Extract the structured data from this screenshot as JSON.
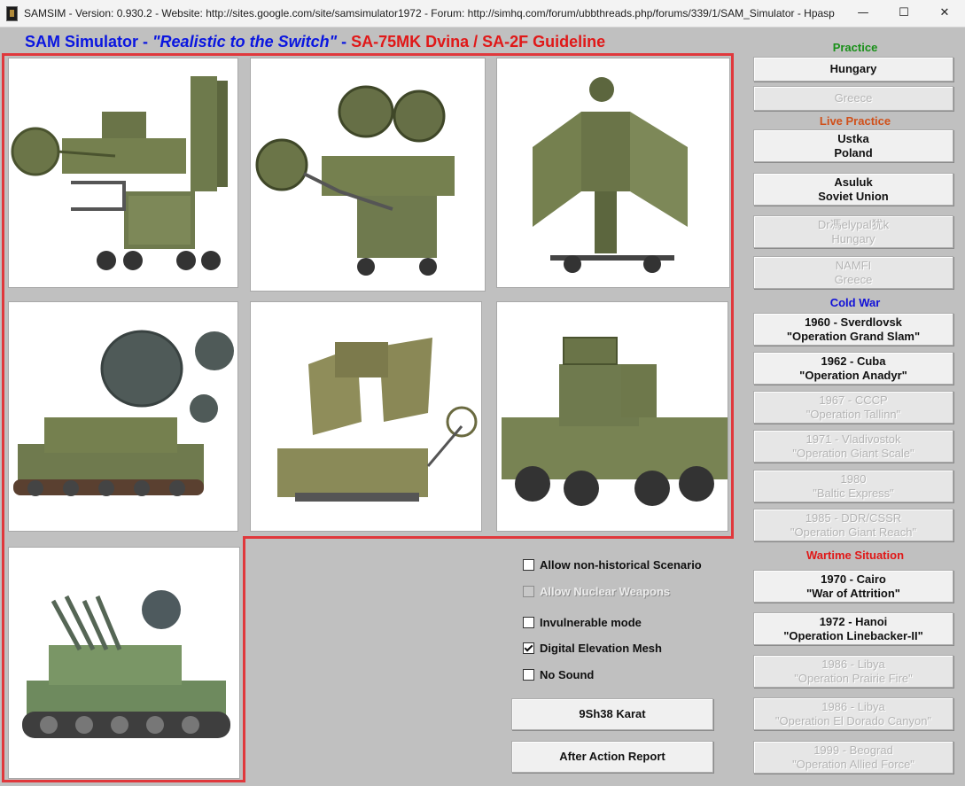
{
  "window": {
    "title": "SAMSIM - Version: 0.930.2 - Website: http://sites.google.com/site/samsimulator1972 - Forum: http://simhq.com/forum/ubbthreads.php/forums/339/1/SAM_Simulator - Hpasp",
    "minimize_glyph": "—",
    "maximize_glyph": "☐",
    "close_glyph": "✕"
  },
  "header": {
    "part1": "SAM Simulator - ",
    "part2": "\"Realistic to the Switch\"",
    "part3": " - ",
    "part4": " SA-75MK Dvina / SA-2F Guideline"
  },
  "systems": [
    {
      "icon": "radar-van-icon"
    },
    {
      "icon": "twin-dish-radar-icon"
    },
    {
      "icon": "folding-radar-tower-icon"
    },
    {
      "icon": "tracked-radar-vehicle-icon"
    },
    {
      "icon": "radar-trailer-icon"
    },
    {
      "icon": "wheeled-sam-vehicle-icon"
    },
    {
      "icon": "zsu-anti-aircraft-gun-icon"
    }
  ],
  "options": {
    "non_historical": {
      "label": "Allow non-historical Scenario",
      "checked": false
    },
    "nuclear": {
      "label": "Allow Nuclear Weapons",
      "checked": false
    },
    "invulnerable": {
      "label": "Invulnerable mode",
      "checked": false
    },
    "dem": {
      "label": "Digital Elevation Mesh",
      "checked": true
    },
    "no_sound": {
      "label": "No Sound",
      "checked": false
    }
  },
  "actions": {
    "karat": "9Sh38 Karat",
    "aar": "After Action Report"
  },
  "sections": {
    "practice": {
      "label": "Practice",
      "color": "#189018"
    },
    "live_practice": {
      "label": "Live Practice",
      "color": "#d0501a"
    },
    "cold_war": {
      "label": "Cold War",
      "color": "#1010d8"
    },
    "wartime": {
      "label": "Wartime Situation",
      "color": "#e01818"
    }
  },
  "scenarios": {
    "practice": [
      {
        "line1": "Hungary",
        "line2": "",
        "enabled": true
      },
      {
        "line1": "Greece",
        "line2": "",
        "enabled": false
      }
    ],
    "live_practice": [
      {
        "line1": "Ustka",
        "line2": "Poland",
        "enabled": true
      },
      {
        "line1": "Asuluk",
        "line2": "Soviet Union",
        "enabled": true
      },
      {
        "line1": "Dr馮elypal犹k",
        "line2": "Hungary",
        "enabled": false
      },
      {
        "line1": "NAMFI",
        "line2": "Greece",
        "enabled": false
      }
    ],
    "cold_war": [
      {
        "line1": "1960 - Sverdlovsk",
        "line2": "\"Operation Grand Slam\"",
        "enabled": true
      },
      {
        "line1": "1962 - Cuba",
        "line2": "\"Operation Anadyr\"",
        "enabled": true
      },
      {
        "line1": "1967 - CCCP",
        "line2": "\"Operation Tallinn\"",
        "enabled": false
      },
      {
        "line1": "1971 - Vladivostok",
        "line2": "\"Operation Giant Scale\"",
        "enabled": false
      },
      {
        "line1": "1980",
        "line2": "\"Baltic Express\"",
        "enabled": false
      },
      {
        "line1": "1985 - DDR/CSSR",
        "line2": "\"Operation Giant Reach\"",
        "enabled": false
      }
    ],
    "wartime": [
      {
        "line1": "1970 - Cairo",
        "line2": "\"War of Attrition\"",
        "enabled": true
      },
      {
        "line1": "1972 - Hanoi",
        "line2": "\"Operation Linebacker-II\"",
        "enabled": true
      },
      {
        "line1": "1986 - Libya",
        "line2": "\"Operation Prairie Fire\"",
        "enabled": false
      },
      {
        "line1": "1986 - Libya",
        "line2": "\"Operation El Dorado Canyon\"",
        "enabled": false
      },
      {
        "line1": "1999 - Beograd",
        "line2": "\"Operation Allied Force\"",
        "enabled": false
      }
    ]
  }
}
